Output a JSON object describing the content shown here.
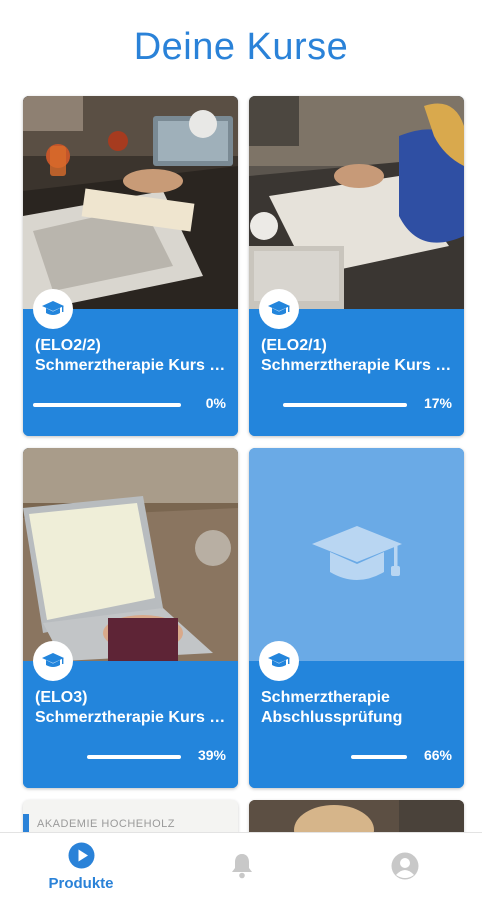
{
  "page": {
    "title": "Deine Kurse"
  },
  "courses": [
    {
      "line1": "(ELO2/2)",
      "line2": "Schmerztherapie Kurs …",
      "progress_label": "0%",
      "progress": 0
    },
    {
      "line1": "(ELO2/1)",
      "line2": "Schmerztherapie Kurs …",
      "progress_label": "17%",
      "progress": 17
    },
    {
      "line1": "(ELO3)",
      "line2": "Schmerztherapie Kurs …",
      "progress_label": "39%",
      "progress": 39
    },
    {
      "line1": "Schmerztherapie",
      "line2": "Abschlussprüfung",
      "progress_label": "66%",
      "progress": 66
    }
  ],
  "peek_card": {
    "logo_text": "AKADEMIE HOCHEHOLZ"
  },
  "bottom_nav": {
    "items": [
      {
        "label": "Produkte",
        "icon": "play-circle-icon",
        "active": true
      },
      {
        "label": "",
        "icon": "bell-icon",
        "active": false
      },
      {
        "label": "",
        "icon": "account-icon",
        "active": false
      }
    ]
  },
  "colors": {
    "accent": "#2a82d8",
    "card": "#2385dc",
    "card_placeholder": "#6aaae6",
    "inactive_icon": "#c8c8c8"
  }
}
